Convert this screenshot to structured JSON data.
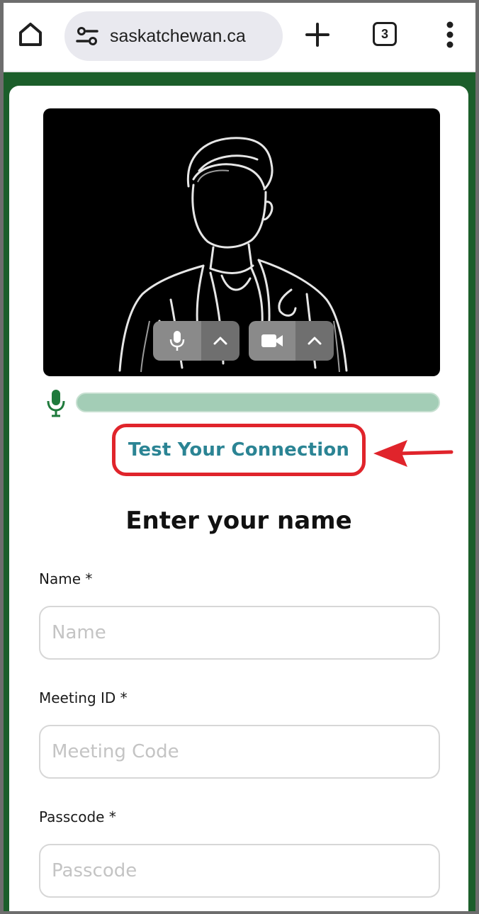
{
  "browser": {
    "url": "saskatchewan.ca",
    "tab_count": "3"
  },
  "page": {
    "test_connection_label": "Test Your Connection",
    "heading": "Enter your name",
    "form": {
      "name_label": "Name *",
      "name_placeholder": "Name",
      "meeting_label": "Meeting ID *",
      "meeting_placeholder": "Meeting Code",
      "passcode_label": "Passcode *",
      "passcode_placeholder": "Passcode"
    }
  },
  "colors": {
    "page_frame": "#1b5e2a",
    "link": "#2b8494",
    "highlight": "#e0242b",
    "mic_level": "#a3cdb6",
    "mic_icon": "#1f7a3c"
  }
}
